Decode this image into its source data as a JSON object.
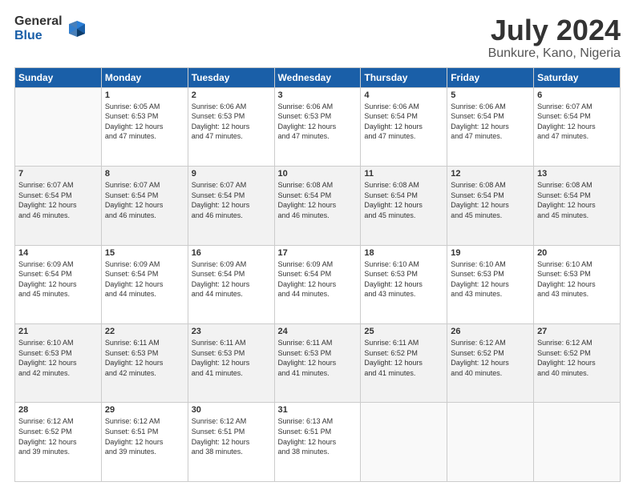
{
  "header": {
    "logo_general": "General",
    "logo_blue": "Blue",
    "month_year": "July 2024",
    "location": "Bunkure, Kano, Nigeria"
  },
  "columns": [
    "Sunday",
    "Monday",
    "Tuesday",
    "Wednesday",
    "Thursday",
    "Friday",
    "Saturday"
  ],
  "weeks": [
    [
      {
        "day": "",
        "text": ""
      },
      {
        "day": "1",
        "text": "Sunrise: 6:05 AM\nSunset: 6:53 PM\nDaylight: 12 hours\nand 47 minutes."
      },
      {
        "day": "2",
        "text": "Sunrise: 6:06 AM\nSunset: 6:53 PM\nDaylight: 12 hours\nand 47 minutes."
      },
      {
        "day": "3",
        "text": "Sunrise: 6:06 AM\nSunset: 6:53 PM\nDaylight: 12 hours\nand 47 minutes."
      },
      {
        "day": "4",
        "text": "Sunrise: 6:06 AM\nSunset: 6:54 PM\nDaylight: 12 hours\nand 47 minutes."
      },
      {
        "day": "5",
        "text": "Sunrise: 6:06 AM\nSunset: 6:54 PM\nDaylight: 12 hours\nand 47 minutes."
      },
      {
        "day": "6",
        "text": "Sunrise: 6:07 AM\nSunset: 6:54 PM\nDaylight: 12 hours\nand 47 minutes."
      }
    ],
    [
      {
        "day": "7",
        "text": "Sunrise: 6:07 AM\nSunset: 6:54 PM\nDaylight: 12 hours\nand 46 minutes."
      },
      {
        "day": "8",
        "text": "Sunrise: 6:07 AM\nSunset: 6:54 PM\nDaylight: 12 hours\nand 46 minutes."
      },
      {
        "day": "9",
        "text": "Sunrise: 6:07 AM\nSunset: 6:54 PM\nDaylight: 12 hours\nand 46 minutes."
      },
      {
        "day": "10",
        "text": "Sunrise: 6:08 AM\nSunset: 6:54 PM\nDaylight: 12 hours\nand 46 minutes."
      },
      {
        "day": "11",
        "text": "Sunrise: 6:08 AM\nSunset: 6:54 PM\nDaylight: 12 hours\nand 45 minutes."
      },
      {
        "day": "12",
        "text": "Sunrise: 6:08 AM\nSunset: 6:54 PM\nDaylight: 12 hours\nand 45 minutes."
      },
      {
        "day": "13",
        "text": "Sunrise: 6:08 AM\nSunset: 6:54 PM\nDaylight: 12 hours\nand 45 minutes."
      }
    ],
    [
      {
        "day": "14",
        "text": "Sunrise: 6:09 AM\nSunset: 6:54 PM\nDaylight: 12 hours\nand 45 minutes."
      },
      {
        "day": "15",
        "text": "Sunrise: 6:09 AM\nSunset: 6:54 PM\nDaylight: 12 hours\nand 44 minutes."
      },
      {
        "day": "16",
        "text": "Sunrise: 6:09 AM\nSunset: 6:54 PM\nDaylight: 12 hours\nand 44 minutes."
      },
      {
        "day": "17",
        "text": "Sunrise: 6:09 AM\nSunset: 6:54 PM\nDaylight: 12 hours\nand 44 minutes."
      },
      {
        "day": "18",
        "text": "Sunrise: 6:10 AM\nSunset: 6:53 PM\nDaylight: 12 hours\nand 43 minutes."
      },
      {
        "day": "19",
        "text": "Sunrise: 6:10 AM\nSunset: 6:53 PM\nDaylight: 12 hours\nand 43 minutes."
      },
      {
        "day": "20",
        "text": "Sunrise: 6:10 AM\nSunset: 6:53 PM\nDaylight: 12 hours\nand 43 minutes."
      }
    ],
    [
      {
        "day": "21",
        "text": "Sunrise: 6:10 AM\nSunset: 6:53 PM\nDaylight: 12 hours\nand 42 minutes."
      },
      {
        "day": "22",
        "text": "Sunrise: 6:11 AM\nSunset: 6:53 PM\nDaylight: 12 hours\nand 42 minutes."
      },
      {
        "day": "23",
        "text": "Sunrise: 6:11 AM\nSunset: 6:53 PM\nDaylight: 12 hours\nand 41 minutes."
      },
      {
        "day": "24",
        "text": "Sunrise: 6:11 AM\nSunset: 6:53 PM\nDaylight: 12 hours\nand 41 minutes."
      },
      {
        "day": "25",
        "text": "Sunrise: 6:11 AM\nSunset: 6:52 PM\nDaylight: 12 hours\nand 41 minutes."
      },
      {
        "day": "26",
        "text": "Sunrise: 6:12 AM\nSunset: 6:52 PM\nDaylight: 12 hours\nand 40 minutes."
      },
      {
        "day": "27",
        "text": "Sunrise: 6:12 AM\nSunset: 6:52 PM\nDaylight: 12 hours\nand 40 minutes."
      }
    ],
    [
      {
        "day": "28",
        "text": "Sunrise: 6:12 AM\nSunset: 6:52 PM\nDaylight: 12 hours\nand 39 minutes."
      },
      {
        "day": "29",
        "text": "Sunrise: 6:12 AM\nSunset: 6:51 PM\nDaylight: 12 hours\nand 39 minutes."
      },
      {
        "day": "30",
        "text": "Sunrise: 6:12 AM\nSunset: 6:51 PM\nDaylight: 12 hours\nand 38 minutes."
      },
      {
        "day": "31",
        "text": "Sunrise: 6:13 AM\nSunset: 6:51 PM\nDaylight: 12 hours\nand 38 minutes."
      },
      {
        "day": "",
        "text": ""
      },
      {
        "day": "",
        "text": ""
      },
      {
        "day": "",
        "text": ""
      }
    ]
  ]
}
